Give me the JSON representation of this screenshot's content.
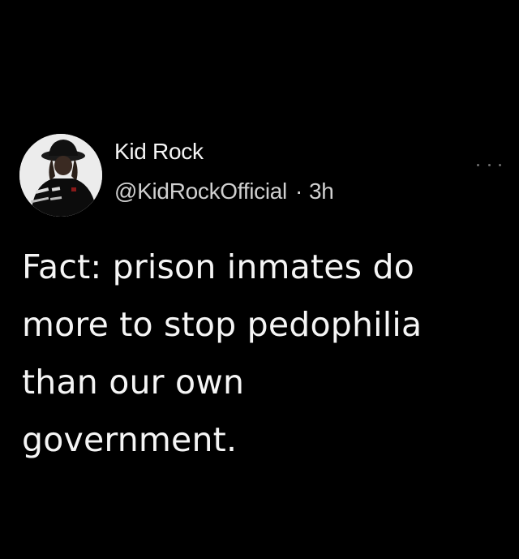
{
  "tweet": {
    "author": {
      "display_name": "Kid Rock",
      "handle": "@KidRockOfficial",
      "avatar_icon": "profile-avatar"
    },
    "separator": "·",
    "timestamp": "3h",
    "more_icon": "more-options-icon",
    "text_lines": [
      "Fact: prison inmates do",
      "more to stop pedophilia",
      "than our own",
      "government."
    ]
  },
  "colors": {
    "background": "#000000",
    "text_primary": "#f5f5f5",
    "text_secondary": "#d0d0d0",
    "icon_muted": "#6e6e6e"
  }
}
